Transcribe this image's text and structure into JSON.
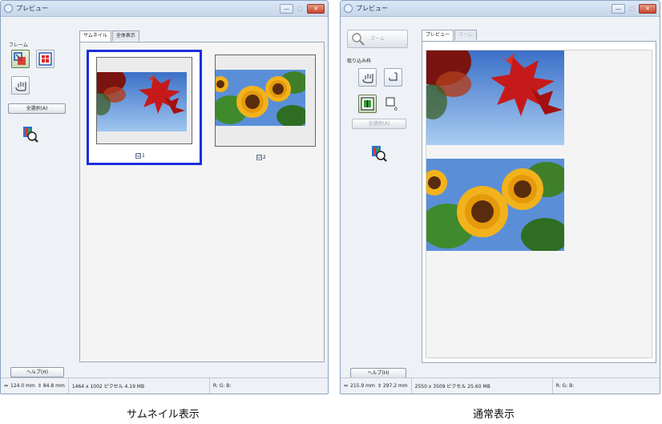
{
  "left_window": {
    "title": "プレビュー",
    "window_buttons": {
      "minimize": "—",
      "maximize": "□",
      "close": "✕"
    },
    "frame_label": "フレーム",
    "select_all_label": "全選択(A)",
    "help_label": "ヘルプ(H)",
    "tabs": [
      "サムネイル",
      "全体表示"
    ],
    "thumbnails": [
      {
        "label": "1",
        "checked": "☑"
      },
      {
        "label": "2",
        "checked": "☑"
      }
    ],
    "status": {
      "width": "124.0 mm",
      "height": "84.8 mm",
      "pixels": "1464 x 1002 ピクセル 4.19 MB",
      "rgb": "R: G: B:"
    },
    "icons": [
      "select-frame-icon",
      "auto-frame-icon",
      "hand-icon",
      "image-adjust-icon"
    ]
  },
  "right_window": {
    "title": "プレビュー",
    "window_buttons": {
      "minimize": "—",
      "maximize": "□",
      "close": "✕"
    },
    "zoom_label": "ズーム",
    "crop_label": "取り込み枠",
    "select_all_label": "全選択(A)",
    "help_label": "ヘルプ(H)",
    "tabs": [
      "プレビュー",
      "ズーム"
    ],
    "frame_count": "0",
    "status": {
      "width": "215.9 mm",
      "height": "297.2 mm",
      "pixels": "2550 x 3509 ピクセル 25.60 MB",
      "rgb": "R: G: B:"
    },
    "icons": [
      "zoom-icon",
      "hand-icon",
      "frame-icon",
      "auto-frame-icon",
      "empty-frame-icon",
      "image-adjust-icon"
    ]
  },
  "captions": {
    "left": "サムネイル表示",
    "right": "通常表示"
  },
  "colors": {
    "selection_border": "#1a2fdc",
    "sky": "#4d86d6",
    "maple": "#c61a1a",
    "sunflower": "#f2b21b",
    "leaf": "#3f8a2c"
  }
}
